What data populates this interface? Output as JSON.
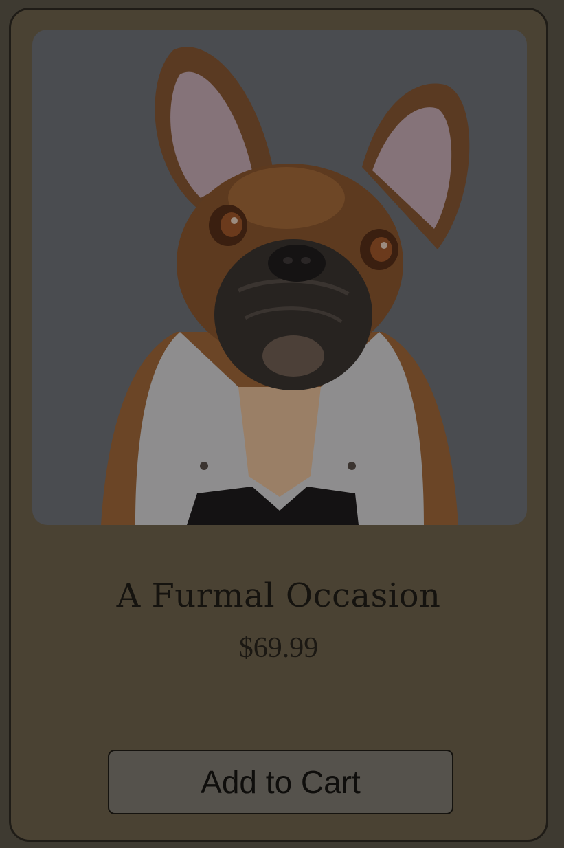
{
  "product": {
    "title": "A Furmal Occasion",
    "price": "$69.99",
    "image_alt": "French bulldog in a white vest and black bow tie",
    "add_to_cart_label": "Add to Cart"
  },
  "colors": {
    "page_background": "#3e3a31",
    "card_background": "#4a4233",
    "photo_background": "#4a4c50",
    "button_background": "#55524c",
    "text": "#15130f"
  }
}
